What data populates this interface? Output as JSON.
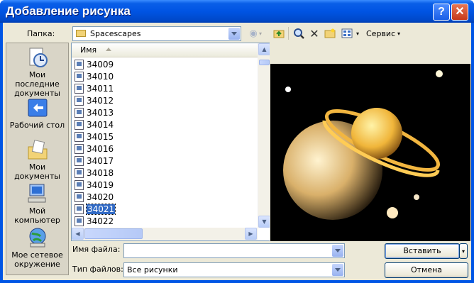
{
  "title": "Добавление рисунка",
  "titlebar": {
    "help_label": "?",
    "close_label": "✕"
  },
  "folder": {
    "label": "Папка:",
    "value": "Spacescapes"
  },
  "toolbar": {
    "service_label": "Сервис"
  },
  "places": [
    {
      "name": "recent",
      "label": "Мои последние документы",
      "icon": "recent-documents-icon"
    },
    {
      "name": "desktop",
      "label": "Рабочий стол",
      "icon": "desktop-icon"
    },
    {
      "name": "documents",
      "label": "Мои документы",
      "icon": "my-documents-icon"
    },
    {
      "name": "computer",
      "label": "Мой компьютер",
      "icon": "my-computer-icon"
    },
    {
      "name": "network",
      "label": "Мое сетевое окружение",
      "icon": "network-icon"
    }
  ],
  "filelist": {
    "column_header": "Имя",
    "files": [
      "34009",
      "34010",
      "34011",
      "34012",
      "34013",
      "34014",
      "34015",
      "34016",
      "34017",
      "34018",
      "34019",
      "34020",
      "34021",
      "34022"
    ],
    "selected": "34021"
  },
  "filename": {
    "label": "Имя файла:",
    "value": ""
  },
  "filetype": {
    "label": "Тип файлов:",
    "value": "Все рисунки"
  },
  "buttons": {
    "insert": "Вставить",
    "cancel": "Отмена"
  },
  "colors": {
    "title_bar": "#0054e3",
    "dialog_bg": "#ece9d8",
    "selection": "#316ac5"
  }
}
